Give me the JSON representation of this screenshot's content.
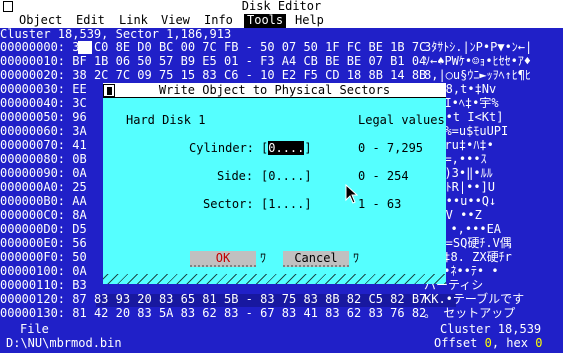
{
  "window": {
    "title": "Disk Editor",
    "sys_menu_glyph": "[]"
  },
  "menubar": [
    {
      "label": "Object",
      "selected": false
    },
    {
      "label": "Edit",
      "selected": false
    },
    {
      "label": "Link",
      "selected": false
    },
    {
      "label": "View",
      "selected": false
    },
    {
      "label": "Info",
      "selected": false
    },
    {
      "label": "Tools",
      "selected": true
    },
    {
      "label": "Help",
      "selected": false
    }
  ],
  "status": {
    "cluster_sector": "Cluster 18,539, Sector 1,186,913"
  },
  "hex_rows": [
    {
      "offset": "00000000:",
      "bytes": "33 C0 8E D0 BC 00 7C FB - 50 07 50 1F FC BE 1B 7C",
      "ascii": "3ﾀｻﾄｼ.|ﾝP•P▼•ﾝ←|"
    },
    {
      "offset": "00000010:",
      "bytes": "BF 1B 06 50 57 B9 E5 01 - F3 A4 CB BE BE 07 B1 04",
      "ascii": "ｿ←♠PWｹ•☺ｮ•ﾋｾｾ•ｱ♦"
    },
    {
      "offset": "00000020:",
      "bytes": "38 2C 7C 09 75 15 83 C6 - 10 E2 F5 CD 18 8B 14 8B",
      "ascii": "8,|○u§ｳﾆ►ｯｦﾍ↑ﾋ¶ﾋ"
    },
    {
      "offset": "00000030:",
      "bytes": "EE",
      "ascii": "It•8,t•‡Nv"
    },
    {
      "offset": "00000040:",
      "bytes": "3C",
      "ascii": "ｻ|,I•ﾍ‡•宇%"
    },
    {
      "offset": "00000050:",
      "bytes": "96",
      "ascii": "I•<•t I<Kt]"
    },
    {
      "offset": "00000060:",
      "bytes": "3A",
      "ascii": "ﾛ=F%=u$ﾓuUPI"
    },
    {
      "offset": "00000070:",
      "bytes": "41",
      "ascii": "ｲ•Uru‡•ﾊ‡•"
    },
    {
      "offset": "00000080:",
      "bytes": "0B",
      "ascii": "V$ｿ=,•••ｽ"
    },
    {
      "offset": "00000090:",
      "bytes": "0A",
      "ascii": "0ﾏ•)3•‖•ﾙﾙ"
    },
    {
      "offset": "000000A0:",
      "bytes": "25",
      "ascii": "•r)ﾄR|••]U"
    },
    {
      "offset": "000000B0:",
      "bytes": "AA",
      "ascii": "Xtu••u••Q↓"
    },
    {
      "offset": "000000C0:",
      "bytes": "8A",
      "ascii": "•F V ••Z"
    },
    {
      "offset": "000000D0:",
      "bytes": "D5",
      "ascii": "ｳﾀ• •,•••EA"
    },
    {
      "offset": "000000E0:",
      "bytes": "56",
      "ascii": "VRP=SQ硬ﾁ.V偶"
    },
    {
      "offset": "000000F0:",
      "bytes": "50",
      "ascii": "ｾ8ﾁ‡8. ZX硬ﾁr"
    },
    {
      "offset": "00000100:",
      "bytes": "0A",
      "ascii": "ﾖ.ﾀ•ﾈ••ﾃ• •"
    },
    {
      "offset": "00000110:",
      "bytes": "B3",
      "ascii": "パーティシ"
    },
    {
      "offset": "00000120:",
      "bytes": "87 83 93 20 83 65 81 5B - 83 75 83 8B 82 C5 82 B7",
      "ascii": "KK.•テーブルです"
    },
    {
      "offset": "00000130:",
      "bytes": "81 42 20 83 5A 83 62 83 - 67 83 41 83 62 83 76 82",
      "ascii": "。 セットアップ"
    }
  ],
  "bottom": {
    "object_label": "File",
    "object_name": "D:\\NU\\mbrmod.bin",
    "cluster": "Cluster 18,539",
    "offset_label": "Offset",
    "offset_value": "0",
    "hex_label": ", hex",
    "hex_value": "0"
  },
  "dialog": {
    "title": "Write Object to Physical Sectors",
    "close_glyph": "[]",
    "disk_label": "Hard Disk 1",
    "legal_label": "Legal values",
    "fields": [
      {
        "label": "Cylinder:",
        "cursor": "0",
        "value": "[0....]",
        "range": "0 - 7,295"
      },
      {
        "label": "Side:",
        "value": "[0....]",
        "range": "0 - 254"
      },
      {
        "label": "Sector:",
        "value": "[1....]",
        "range": "1 - 63"
      }
    ],
    "ok_label": "OK",
    "cancel_label": "Cancel",
    "btn_trail": "ﾜ"
  },
  "colors": {
    "background": "#2020c8",
    "dialog": "#55ffff",
    "menu_sel": "#000000",
    "highlight_text": "#ffff00"
  }
}
